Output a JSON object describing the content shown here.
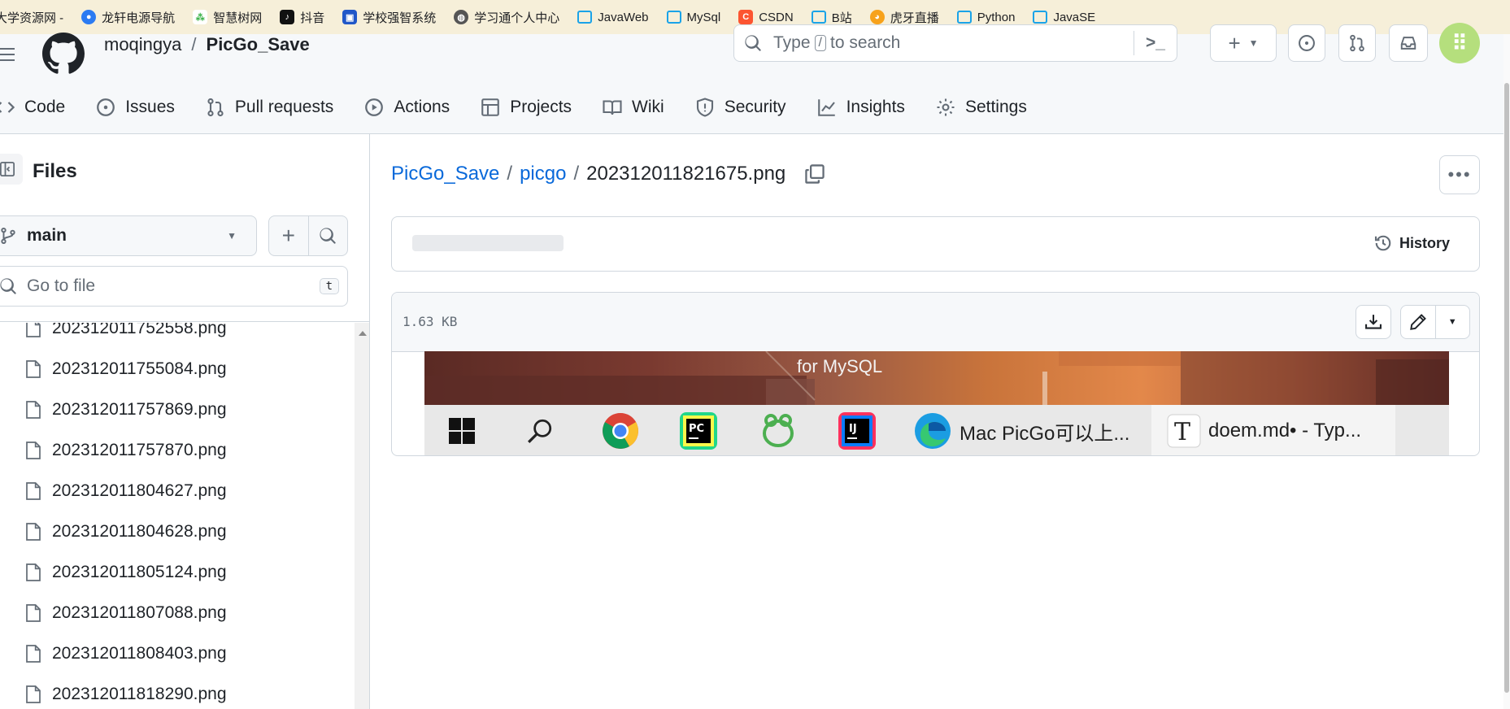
{
  "bookmarks": [
    {
      "label": "大学资源网 -",
      "icon": "none"
    },
    {
      "label": "龙轩电源导航",
      "icon": "blue-shield-icon"
    },
    {
      "label": "智慧树网",
      "icon": "tree-icon"
    },
    {
      "label": "抖音",
      "icon": "tiktok-icon"
    },
    {
      "label": "学校强智系统",
      "icon": "blue-square-icon"
    },
    {
      "label": "学习通个人中心",
      "icon": "globe-icon"
    },
    {
      "label": "JavaWeb",
      "icon": "bilibili-tv-icon"
    },
    {
      "label": "MySql",
      "icon": "bilibili-tv-icon"
    },
    {
      "label": "CSDN",
      "icon": "csdn-icon"
    },
    {
      "label": "B站",
      "icon": "bilibili-tv-icon"
    },
    {
      "label": "虎牙直播",
      "icon": "huya-icon"
    },
    {
      "label": "Python",
      "icon": "bilibili-tv-icon"
    },
    {
      "label": "JavaSE",
      "icon": "bilibili-tv-icon"
    }
  ],
  "header": {
    "owner": "moqingya",
    "separator": "/",
    "repo": "PicGo_Save",
    "search": {
      "prefix": "Type",
      "key": "/",
      "suffix": "to search"
    }
  },
  "tabs": [
    {
      "label": "Code",
      "icon": "code-icon"
    },
    {
      "label": "Issues",
      "icon": "issue-icon"
    },
    {
      "label": "Pull requests",
      "icon": "pull-request-icon"
    },
    {
      "label": "Actions",
      "icon": "play-icon"
    },
    {
      "label": "Projects",
      "icon": "table-icon"
    },
    {
      "label": "Wiki",
      "icon": "book-icon"
    },
    {
      "label": "Security",
      "icon": "shield-icon"
    },
    {
      "label": "Insights",
      "icon": "graph-icon"
    },
    {
      "label": "Settings",
      "icon": "gear-icon"
    }
  ],
  "sidebar": {
    "title": "Files",
    "branch": "main",
    "goto_placeholder": "Go to file",
    "goto_shortcut": "t",
    "files": [
      "202312011752558.png",
      "202312011755084.png",
      "202312011757869.png",
      "202312011757870.png",
      "202312011804627.png",
      "202312011804628.png",
      "202312011805124.png",
      "202312011807088.png",
      "202312011808403.png",
      "202312011818290.png"
    ]
  },
  "breadcrumb": {
    "repo": "PicGo_Save",
    "folder": "picgo",
    "file": "202312011821675.png",
    "sep": "/"
  },
  "commit": {
    "history_label": "History"
  },
  "file": {
    "size": "1.63 KB"
  },
  "preview": {
    "overlay_text": "for MySQL",
    "taskbar": [
      {
        "label": "",
        "icon": "windows-start-icon"
      },
      {
        "label": "",
        "icon": "search-icon"
      },
      {
        "label": "",
        "icon": "chrome-icon"
      },
      {
        "label": "",
        "icon": "pycharm-icon"
      },
      {
        "label": "",
        "icon": "navicat-icon"
      },
      {
        "label": "",
        "icon": "intellij-icon"
      },
      {
        "label": "Mac PicGo可以上...",
        "icon": "edge-icon"
      },
      {
        "label": "doem.md• - Typ...",
        "icon": "typora-icon"
      }
    ]
  },
  "colors": {
    "link": "#0969da",
    "border": "#d0d7de",
    "header_bg": "#f6f8fa",
    "bookmarks_bg": "#f6efd9"
  }
}
